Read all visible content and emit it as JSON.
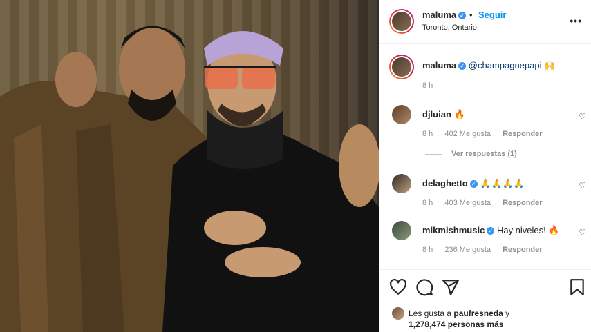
{
  "post": {
    "username": "maluma",
    "verified_glyph": "✓",
    "dot": "•",
    "follow_label": "Seguir",
    "location": "Toronto, Ontario",
    "more_glyph": "•••",
    "icon_names": [
      "verified-icon",
      "more-options-icon",
      "heart-icon",
      "comment-icon",
      "share-icon",
      "save-icon"
    ]
  },
  "caption": {
    "username": "maluma",
    "mention": "@champagnepapi",
    "emoji": "🙌",
    "time": "8 h"
  },
  "comments": [
    {
      "username": "djluian",
      "text": "🔥",
      "time": "8 h",
      "likes": "402 Me gusta",
      "reply": "Responder"
    },
    {
      "username": "delaghetto",
      "text": "🙏🙏🙏🙏",
      "time": "8 h",
      "likes": "403 Me gusta",
      "reply": "Responder"
    },
    {
      "username": "mikmishmusic",
      "text": "Hay niveles! 🔥",
      "time": "8 h",
      "likes": "236 Me gusta",
      "reply": "Responder"
    }
  ],
  "view_replies": "Ver respuestas (1)",
  "likes": {
    "prefix": "Les gusta a",
    "user": "paufresneda",
    "conj": "y",
    "count": "1,278,474",
    "suffix": "personas más"
  },
  "colors": {
    "link": "#0095f6",
    "verified": "#3897f0",
    "muted": "#8e8e8e"
  }
}
